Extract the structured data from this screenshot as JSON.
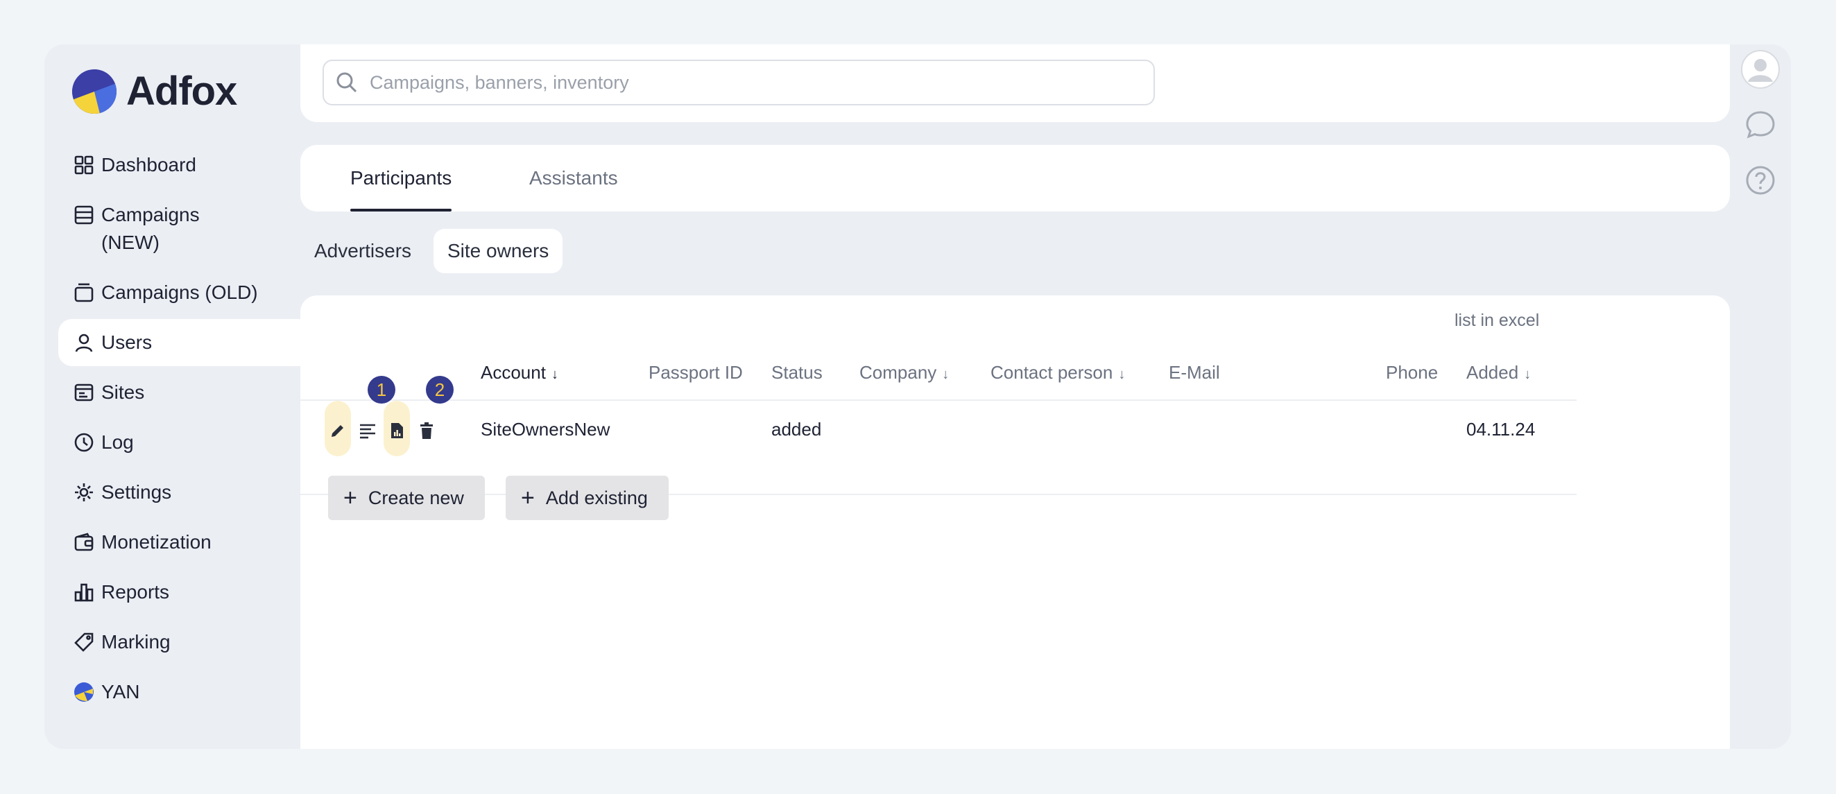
{
  "app": {
    "name": "Adfox"
  },
  "sidebar": {
    "items": [
      {
        "label": "Dashboard",
        "icon": "dashboard-icon"
      },
      {
        "label": "Campaigns (NEW)",
        "icon": "campaigns-new-icon"
      },
      {
        "label": "Campaigns (OLD)",
        "icon": "campaigns-old-icon"
      },
      {
        "label": "Users",
        "icon": "user-icon",
        "active": true
      },
      {
        "label": "Sites",
        "icon": "sites-icon"
      },
      {
        "label": "Log",
        "icon": "clock-icon"
      },
      {
        "label": "Settings",
        "icon": "gear-icon"
      },
      {
        "label": "Monetization",
        "icon": "wallet-icon"
      },
      {
        "label": "Reports",
        "icon": "bar-chart-icon"
      },
      {
        "label": "Marking",
        "icon": "tag-icon"
      },
      {
        "label": "YAN",
        "icon": "yan-logo-icon"
      }
    ]
  },
  "search": {
    "placeholder": "Campaigns, banners, inventory"
  },
  "tabs": [
    {
      "label": "Participants",
      "active": true
    },
    {
      "label": "Assistants",
      "active": false
    }
  ],
  "subtabs": [
    {
      "label": "Advertisers",
      "active": false
    },
    {
      "label": "Site owners",
      "active": true
    }
  ],
  "table": {
    "export_label": "list in excel",
    "columns": [
      "Account",
      "Passport ID",
      "Status",
      "Company",
      "Contact person",
      "E-Mail",
      "Phone",
      "Added"
    ],
    "rows": [
      {
        "account": "SiteOwnersNew",
        "passport_id": "",
        "status": "added",
        "company": "",
        "contact_person": "",
        "email": "",
        "phone": "",
        "added": "04.11.24"
      }
    ],
    "badges": [
      "1",
      "2"
    ]
  },
  "buttons": {
    "create_new": "Create new",
    "add_existing": "Add existing"
  },
  "colors": {
    "accent": "#343a8c",
    "badge_text": "#f5c542",
    "highlight": "#fcf1cf"
  }
}
